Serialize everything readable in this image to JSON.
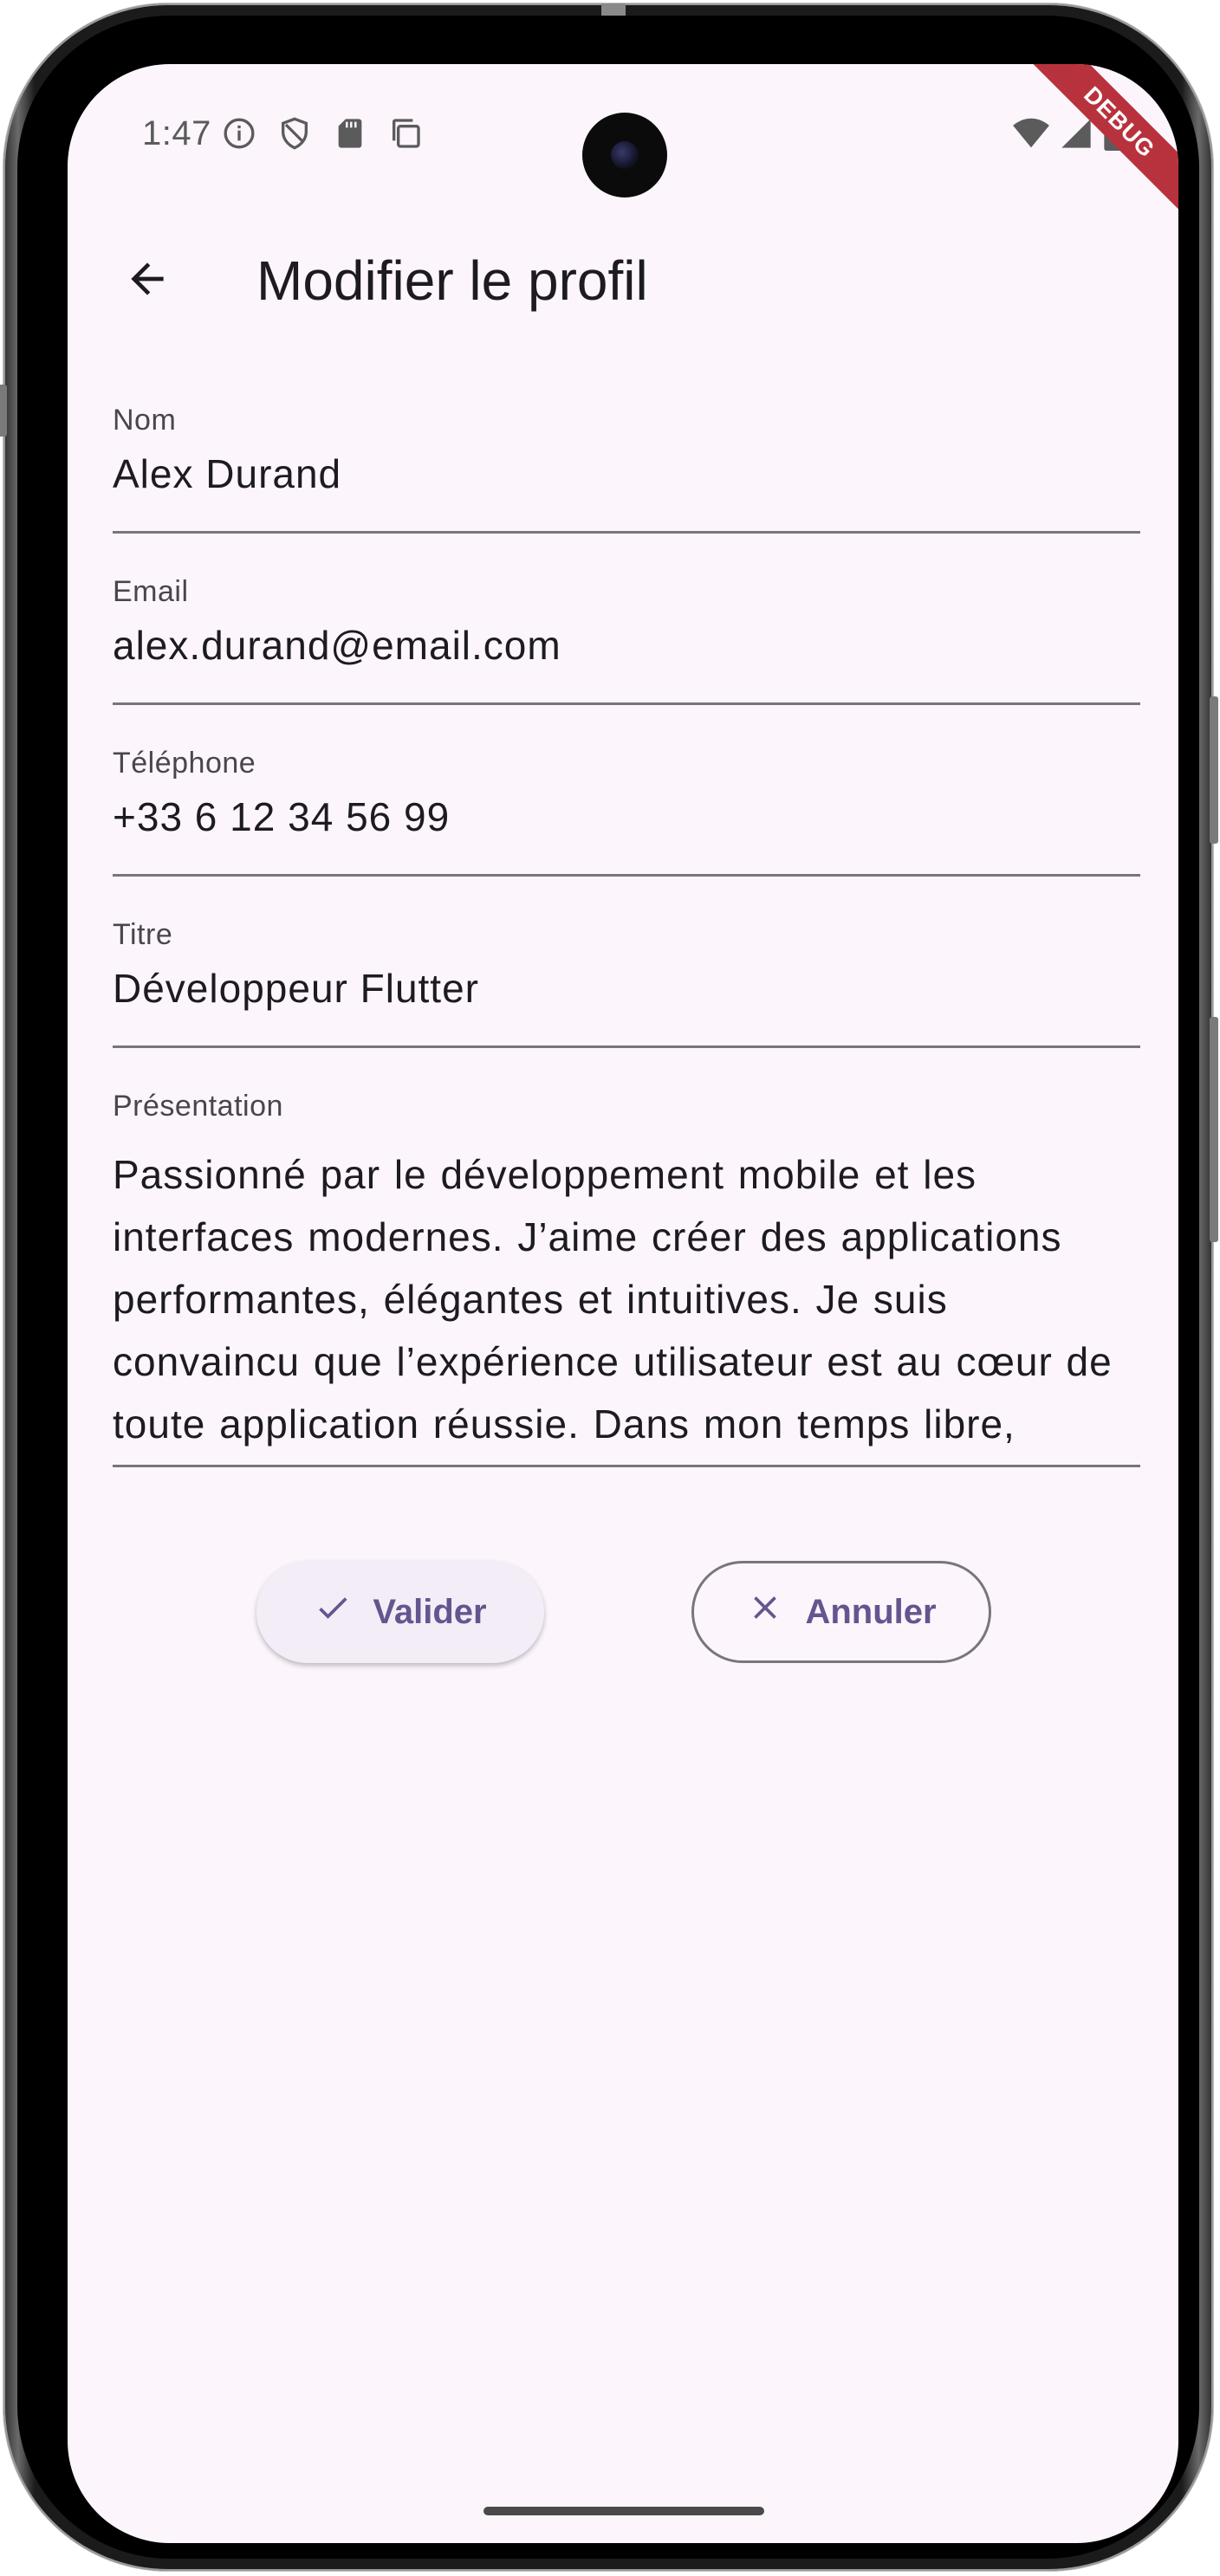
{
  "status_bar": {
    "time": "1:47",
    "left_icons": [
      "info-icon",
      "shield-icon",
      "sd-card-icon",
      "copy-icon"
    ],
    "right_icons": [
      "wifi-icon",
      "signal-icon",
      "battery-icon"
    ],
    "debug_banner": "DEBUG"
  },
  "app_bar": {
    "back_icon": "arrow-back-icon",
    "title": "Modifier le profil"
  },
  "form": {
    "name": {
      "label": "Nom",
      "value": "Alex Durand"
    },
    "email": {
      "label": "Email",
      "value": "alex.durand@email.com"
    },
    "phone": {
      "label": "Téléphone",
      "value": "+33 6 12 34 56 99"
    },
    "title": {
      "label": "Titre",
      "value": "Développeur Flutter"
    },
    "bio": {
      "label": "Présentation",
      "value": "Passionné par le développement mobile et les interfaces modernes. J’aime créer des applications performantes, élégantes et intuitives. Je suis convaincu que l’expérience utilisateur est au cœur de toute application réussie. Dans mon temps libre,"
    }
  },
  "actions": {
    "validate": {
      "label": "Valider",
      "icon": "check-icon"
    },
    "cancel": {
      "label": "Annuler",
      "icon": "close-icon"
    }
  },
  "colors": {
    "background": "#fcf6fc",
    "primary": "#65558f",
    "text": "#1d1b20",
    "label": "#49454f",
    "outline": "#79747e",
    "debug": "#b8323d"
  }
}
